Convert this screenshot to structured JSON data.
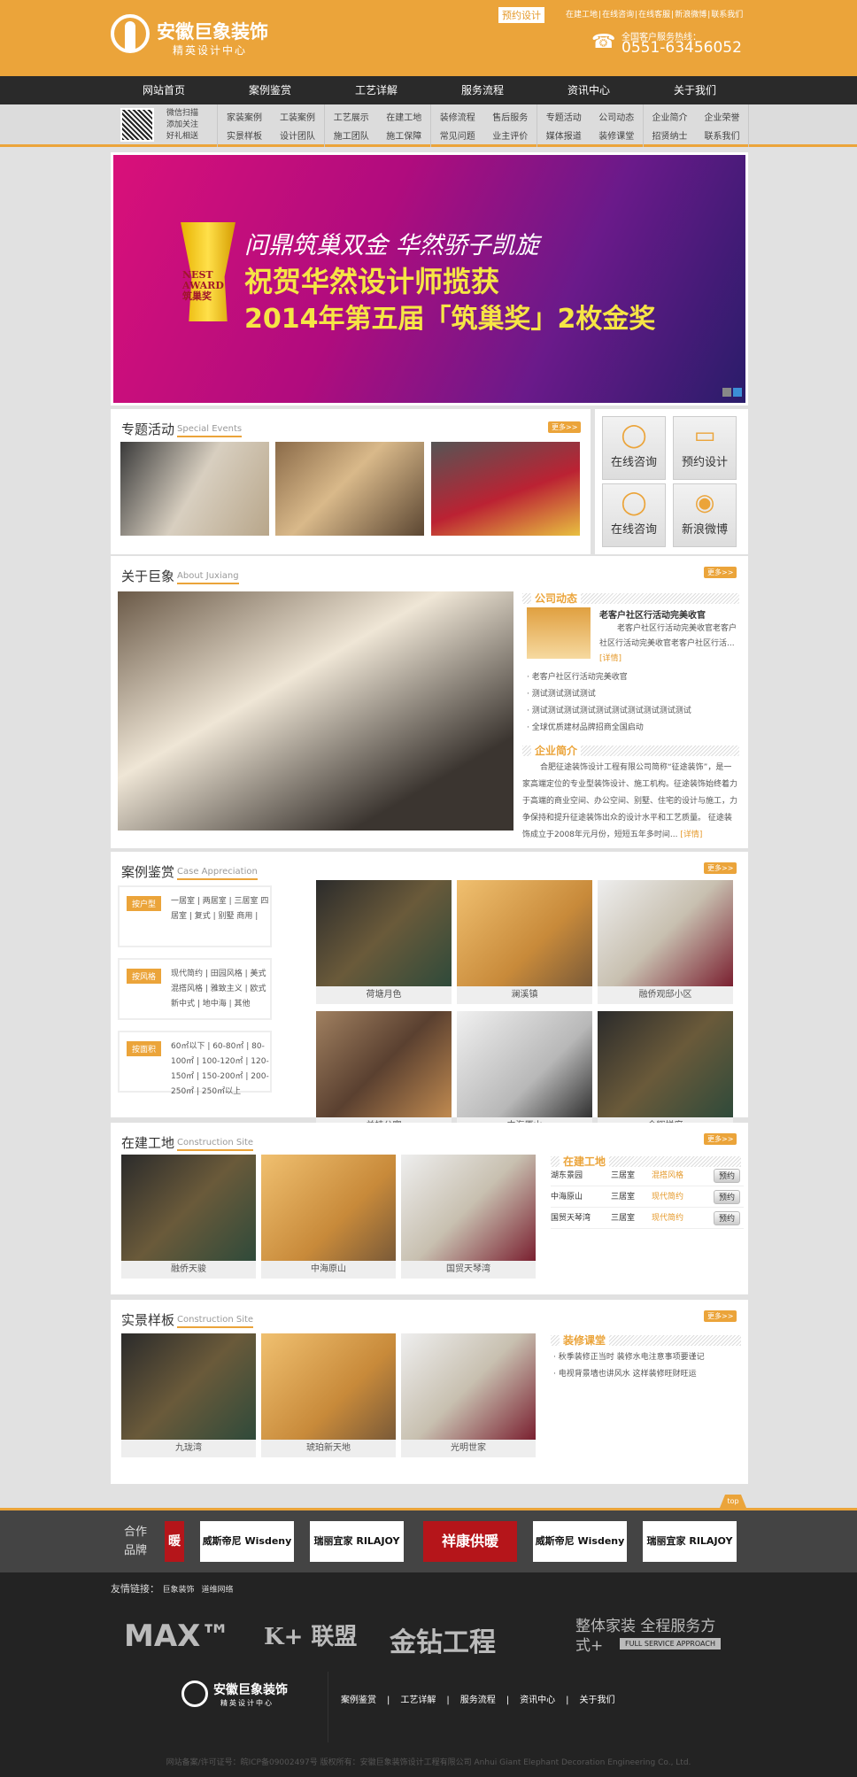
{
  "header": {
    "logo_title": "安徽巨象装饰",
    "logo_subtitle": "精英设计中心",
    "booking": "预约设计",
    "top_links": [
      "在建工地",
      "在线咨询",
      "在线客服",
      "新浪微博",
      "联系我们"
    ],
    "hotline_label": "全国客户服务热线：",
    "hotline": "0551-63456052",
    "phone_icon": "phone-icon"
  },
  "nav": [
    "网站首页",
    "案例鉴赏",
    "工艺详解",
    "服务流程",
    "资讯中心",
    "关于我们"
  ],
  "subnav": {
    "qr_text": [
      "微信扫描",
      "添加关注",
      "好礼相送"
    ],
    "groups": [
      [
        "家装案例",
        "工装案例",
        "实景样板",
        "设计团队"
      ],
      [
        "工艺展示",
        "在建工地",
        "施工团队",
        "施工保障"
      ],
      [
        "装修流程",
        "售后服务",
        "常见问题",
        "业主评价"
      ],
      [
        "专题活动",
        "公司动态",
        "媒体报道",
        "装修课堂"
      ],
      [
        "企业简介",
        "企业荣誉",
        "招贤纳士",
        "联系我们"
      ]
    ]
  },
  "banner": {
    "line1": "问鼎筑巢双金 华然骄子凯旋",
    "line2": "祝贺华然设计师揽获",
    "line3": "2014年第五届「筑巢奖」2枚金奖",
    "trophy_text": "NEST AWARD 筑巢奖",
    "active_slide": 2,
    "slides": 2
  },
  "more": "更多>>",
  "special": {
    "title": "专题活动",
    "en": "Special Events"
  },
  "quick": [
    {
      "label": "在线咨询",
      "icon": "qq-icon"
    },
    {
      "label": "预约设计",
      "icon": "monitor-pen-icon"
    },
    {
      "label": "在线咨询",
      "icon": "qq-icon"
    },
    {
      "label": "新浪微博",
      "icon": "weibo-icon"
    }
  ],
  "about": {
    "title": "关于巨象",
    "en": "About Juxiang",
    "news_head": "公司动态",
    "news_title": "老客户社区行活动完美收官",
    "news_summary": "老客户社区行活动完美收官老客户社区行活动完美收官老客户社区行活...",
    "detail": "[详情]",
    "news_list": [
      "老客户社区行活动完美收官",
      "测试测试测试测试",
      "测试测试测试测试测试测试测试测试测试测试",
      "全球优质建材品牌招商全国启动"
    ],
    "intro_head": "企业简介",
    "intro": "合肥征途装饰设计工程有限公司简称“征途装饰”，是一家高端定位的专业型装饰设计、施工机构。征途装饰始终着力于高端的商业空间、办公空间、别墅、住宅的设计与施工，力争保持和提升征途装饰出众的设计水平和工艺质量。 征途装饰成立于2008年元月份，短短五年多时间..."
  },
  "cases": {
    "title": "案例鉴赏",
    "en": "Case Appreciation",
    "filters": [
      {
        "tag": "按户型",
        "options": "一居室 | 两居室 | 三居室 四居室 | 复式 | 别墅 商用 |"
      },
      {
        "tag": "按风格",
        "options": "现代简约 | 田园风格 | 美式 混搭风格 | 雅致主义 | 欧式 新中式 | 地中海 | 其他"
      },
      {
        "tag": "按面积",
        "options": "60㎡以下 | 60-80㎡ | 80-100㎡ | 100-120㎡ | 120-150㎡ | 150-200㎡ | 200-250㎡ | 250㎡以上"
      }
    ],
    "items": [
      "荷塘月色",
      "澜溪镇",
      "融侨观邸小区",
      "兰桂公寓",
      "中海原山",
      "金辉悦府"
    ]
  },
  "construction": {
    "title": "在建工地",
    "en": "Construction Site",
    "items": [
      "融侨天骏",
      "中海原山",
      "国贸天琴湾"
    ],
    "list_head": "在建工地",
    "rows": [
      {
        "name": "湖东景园",
        "type": "三居室",
        "style": "混搭风格",
        "btn": "预约"
      },
      {
        "name": "中海原山",
        "type": "三居室",
        "style": "现代简约",
        "btn": "预约"
      },
      {
        "name": "国贸天琴湾",
        "type": "三居室",
        "style": "现代简约",
        "btn": "预约"
      }
    ]
  },
  "samples": {
    "title": "实景样板",
    "en": "Construction Site",
    "items": [
      "九珑湾",
      "琥珀新天地",
      "光明世家"
    ],
    "list_head": "装修课堂",
    "list": [
      "秋季装修正当时 装修水电注意事项要谨记",
      "电视背景墙也讲风水 这样装修旺财旺运"
    ]
  },
  "top": "top",
  "partners": {
    "label": "合作品牌",
    "brands": [
      "暖",
      "威斯帝尼 Wisdeny",
      "瑞丽宜家 RILAJOY",
      "祥康供暖",
      "威斯帝尼 Wisdeny",
      "瑞丽宜家 RILAJOY"
    ]
  },
  "footer": {
    "links_label": "友情链接：",
    "links": [
      "巨象装饰",
      "道维网络"
    ],
    "logos": [
      "MAX™",
      "K+ 联盟",
      "金钻工程",
      "整体家装 全程服务方式+",
      "FULL SERVICE APPROACH"
    ],
    "logo_title": "安徽巨象装饰",
    "logo_subtitle": "精英设计中心",
    "nav": [
      "案例鉴赏",
      "工艺详解",
      "服务流程",
      "资讯中心",
      "关于我们"
    ],
    "copyright": "网站备案/许可证号：皖ICP备09002497号 版权所有：安徽巨象装饰设计工程有限公司 Anhui Giant Elephant Decoration Engineering Co., Ltd."
  },
  "colors": {
    "accent": "#eba43a",
    "nav_bg": "#2a2a2a",
    "footer_bg": "#232323"
  }
}
